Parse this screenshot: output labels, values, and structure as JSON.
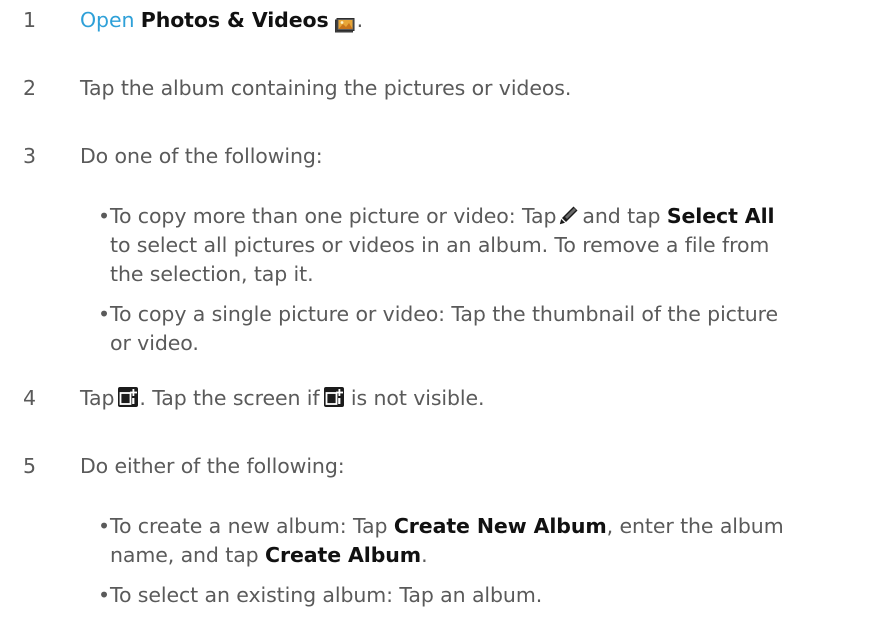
{
  "steps": [
    {
      "number": "1",
      "open_text": "Open",
      "app_name": "Photos & Videos",
      "period": ".",
      "icon": "photos-videos-icon"
    },
    {
      "number": "2",
      "text": "Tap the album containing the pictures or videos."
    },
    {
      "number": "3",
      "text": "Do one of the following:",
      "bullets": [
        {
          "part1": "To copy more than one picture or video: Tap",
          "icon": "pencil-icon",
          "part2": "and tap",
          "bold": "Select All",
          "line2": "to select all pictures or videos in an album. To remove a file from",
          "line3": "the selection, tap it."
        },
        {
          "line1": "To copy a single picture or video: Tap the thumbnail of the picture",
          "line2": "or video."
        }
      ]
    },
    {
      "number": "4",
      "part1": "Tap",
      "part2": ". Tap the screen if",
      "part3": "is not visible.",
      "icon": "copy-to-album-icon"
    },
    {
      "number": "5",
      "text": "Do either of the following:",
      "bullets": [
        {
          "part1": "To create a new album: Tap",
          "bold1": "Create New Album",
          "part2": ", enter the album",
          "part3": "name, and tap",
          "bold2": "Create Album",
          "part4": "."
        },
        {
          "line1": "To select an existing album: Tap an album."
        }
      ]
    }
  ],
  "bullet_char": "•",
  "colors": {
    "body_text": "#5a5a5a",
    "link": "#2ea0d8",
    "bold_text": "#111111"
  }
}
